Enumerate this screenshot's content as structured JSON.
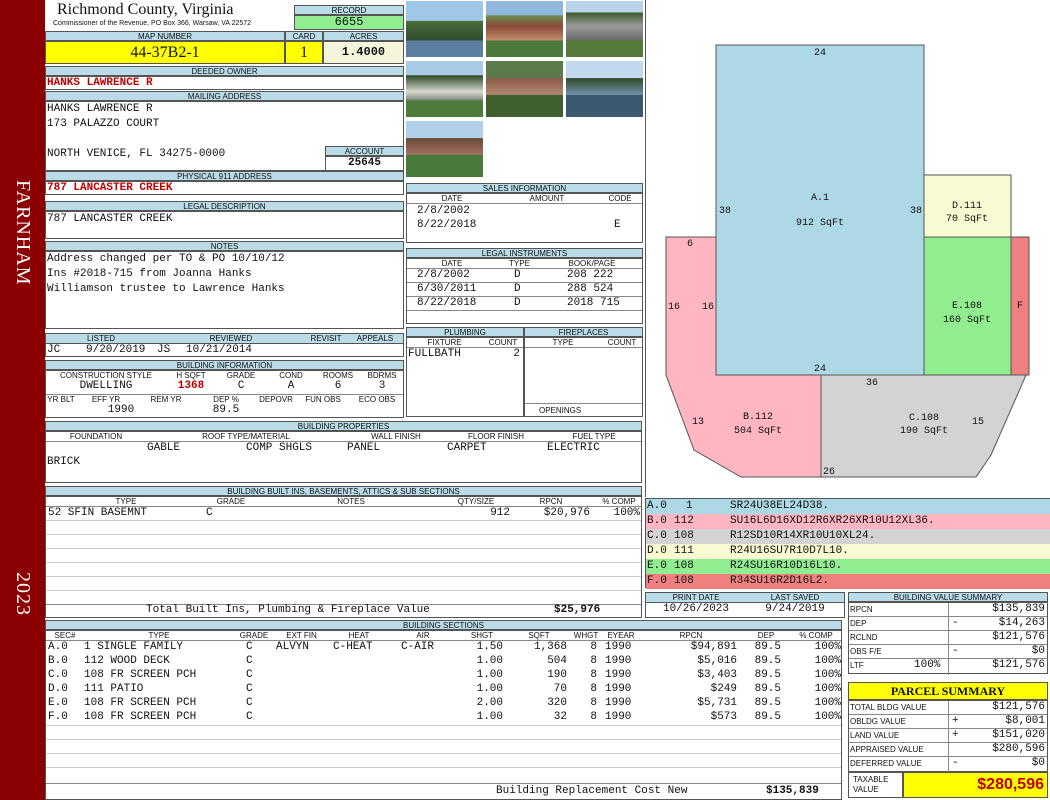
{
  "side": {
    "town": "FARNHAM",
    "year": "2023"
  },
  "header": {
    "county": "Richmond County, Virginia",
    "commissioner": "Commissioner of the Revenue, PO Box 366, Warsaw, VA 22572",
    "record_label": "RECORD",
    "record": "6655",
    "map_label": "MAP NUMBER",
    "map_number": "44-37B2-1",
    "card_label": "CARD",
    "card": "1",
    "acres_label": "ACRES",
    "acres": "1.4000"
  },
  "owner": {
    "label": "DEEDED OWNER",
    "name": "HANKS LAWRENCE R",
    "mail_label": "MAILING ADDRESS",
    "mail_lines": [
      "HANKS LAWRENCE R",
      "173 PALAZZO COURT",
      "",
      "NORTH VENICE, FL 34275-0000"
    ],
    "account_label": "ACCOUNT",
    "account": "25645",
    "phys_label": "PHYSICAL 911 ADDRESS",
    "phys": "787 LANCASTER CREEK"
  },
  "legal": {
    "label": "LEGAL DESCRIPTION",
    "text": "787 LANCASTER CREEK"
  },
  "notes": {
    "label": "NOTES",
    "lines": [
      "Address changed per TO & PO 10/10/12",
      "Ins #2018-715 from Joanna Hanks",
      "Williamson trustee to Lawrence Hanks"
    ]
  },
  "sales": {
    "label": "SALES INFORMATION",
    "cols": [
      "DATE",
      "AMOUNT",
      "CODE"
    ],
    "rows": [
      [
        "2/8/2002",
        "",
        ""
      ],
      [
        "8/22/2018",
        "",
        "E"
      ]
    ]
  },
  "instruments": {
    "label": "LEGAL INSTRUMENTS",
    "cols": [
      "DATE",
      "TYPE",
      "BOOK/PAGE"
    ],
    "rows": [
      [
        "2/8/2002",
        "D",
        "208 222"
      ],
      [
        "6/30/2011",
        "D",
        "288 524"
      ],
      [
        "8/22/2018",
        "D",
        "2018 715"
      ]
    ]
  },
  "listed": {
    "cols": [
      "LISTED",
      "REVIEWED",
      "REVISIT",
      "APPEALS"
    ],
    "listed_by": "JC",
    "listed_date": "9/20/2019",
    "reviewed_by": "JS",
    "reviewed_date": "10/21/2014"
  },
  "building_info": {
    "label": "BUILDING INFORMATION",
    "cols": [
      "CONSTRUCTION STYLE",
      "H SQFT",
      "GRADE",
      "COND",
      "ROOMS",
      "BDRMS"
    ],
    "vals": [
      "DWELLING",
      "1368",
      "C",
      "A",
      "6",
      "3"
    ],
    "cols2": [
      "YR BLT",
      "EFF YR",
      "REM YR",
      "DEP %",
      "DEPOVR",
      "FUN OBS",
      "ECO OBS"
    ],
    "vals2": [
      "",
      "1990",
      "",
      "89.5",
      "",
      "",
      ""
    ]
  },
  "plumbing": {
    "label": "PLUMBING",
    "cols": [
      "FIXTURE",
      "COUNT"
    ],
    "rows": [
      [
        "FULLBATH",
        "2"
      ]
    ]
  },
  "fireplaces": {
    "label": "FIREPLACES",
    "cols": [
      "TYPE",
      "COUNT"
    ],
    "openings_label": "OPENINGS"
  },
  "properties": {
    "label": "BUILDING PROPERTIES",
    "cols": [
      "FOUNDATION",
      "ROOF TYPE/MATERIAL",
      "WALL FINISH",
      "FLOOR FINISH",
      "FUEL TYPE"
    ],
    "foundation": "BRICK",
    "roof_type": "GABLE",
    "roof_mat": "COMP SHGLS",
    "wall": "PANEL",
    "floor": "CARPET",
    "fuel": "ELECTRIC"
  },
  "builtins": {
    "label": "BUILDING BUILT INS, BASEMENTS, ATTICS & SUB SECTIONS",
    "cols": [
      "TYPE",
      "GRADE",
      "NOTES",
      "QTY/SIZE",
      "RPCN",
      "% COMP"
    ],
    "rows": [
      [
        "52 SFIN BASEMNT",
        "C",
        "",
        "912",
        "$20,976",
        "100%"
      ]
    ],
    "total_label": "Total Built Ins, Plumbing & Fireplace Value",
    "total": "$25,976"
  },
  "sketch": {
    "labels": [
      {
        "id": "A.1",
        "area": "912 SqFt"
      },
      {
        "id": "B.112",
        "area": "504 SqFt"
      },
      {
        "id": "C.108",
        "area": "190 SqFt"
      },
      {
        "id": "D.111",
        "area": "70 SqFt"
      },
      {
        "id": "E.108",
        "area": "160 SqFt"
      },
      {
        "id": "F",
        "area": ""
      }
    ],
    "dims": [
      "24",
      "38",
      "38",
      "24",
      "6",
      "16",
      "16",
      "36",
      "13",
      "26",
      "15"
    ],
    "colors": {
      "A": "#add8e6",
      "B": "#ffb6c1",
      "C": "#d3d3d3",
      "D": "#fafad2",
      "E": "#90ee90",
      "F": "#f08080"
    }
  },
  "codes": [
    {
      "sec": "A.0",
      "code": "1",
      "desc": "SR24U38EL24D38.",
      "color": "#add8e6"
    },
    {
      "sec": "B.0",
      "code": "112",
      "desc": "SU16L6D16XD12R6XR26XR10U12XL36.",
      "color": "#ffb6c1"
    },
    {
      "sec": "C.0",
      "code": "108",
      "desc": "R12SD10R14XR10U10XL24.",
      "color": "#d3d3d3"
    },
    {
      "sec": "D.0",
      "code": "111",
      "desc": "R24U16SU7R10D7L10.",
      "color": "#fafad2"
    },
    {
      "sec": "E.0",
      "code": "108",
      "desc": "R24SU16R10D16L10.",
      "color": "#90ee90"
    },
    {
      "sec": "F.0",
      "code": "108",
      "desc": "R34SU16R2D16L2.",
      "color": "#f08080"
    }
  ],
  "print": {
    "cols": [
      "PRINT DATE",
      "LAST SAVED"
    ],
    "print_date": "10/26/2023",
    "last_saved": "9/24/2019"
  },
  "value_summary": {
    "label": "BUILDING VALUE SUMMARY",
    "rows": [
      [
        "RPCN",
        "",
        "$135,839"
      ],
      [
        "DEP",
        "-",
        "$14,263"
      ],
      [
        "RCLND",
        "",
        "$121,576"
      ],
      [
        "OBS F/E",
        "-",
        "$0"
      ],
      [
        "LTF",
        "100%",
        "$121,576"
      ]
    ]
  },
  "parcel": {
    "label": "PARCEL SUMMARY",
    "rows": [
      [
        "TOTAL BLDG VALUE",
        "",
        "$121,576"
      ],
      [
        "OBLDG VALUE",
        "+",
        "$8,001"
      ],
      [
        "LAND VALUE",
        "+",
        "$151,020"
      ],
      [
        "APPRAISED VALUE",
        "",
        "$280,596"
      ],
      [
        "DEFERRED VALUE",
        "-",
        "$0"
      ]
    ],
    "taxable_label": "TAXABLE VALUE",
    "taxable": "$280,596"
  },
  "sections": {
    "label": "BUILDING SECTIONS",
    "cols": [
      "SEC#",
      "TYPE",
      "GRADE",
      "EXT FIN",
      "HEAT",
      "AIR",
      "SHGT",
      "SQFT",
      "WHGT",
      "EYEAR",
      "RPCN",
      "DEP",
      "% COMP"
    ],
    "rows": [
      [
        "A.0",
        "1 SINGLE FAMILY",
        "C",
        "ALVYN",
        "C-HEAT",
        "C-AIR",
        "1.50",
        "1,368",
        "8",
        "1990",
        "$94,891",
        "89.5",
        "100%"
      ],
      [
        "B.0",
        "112 WOOD DECK",
        "C",
        "",
        "",
        "",
        "1.00",
        "504",
        "8",
        "1990",
        "$5,016",
        "89.5",
        "100%"
      ],
      [
        "C.0",
        "108 FR SCREEN PCH",
        "C",
        "",
        "",
        "",
        "1.00",
        "190",
        "8",
        "1990",
        "$3,403",
        "89.5",
        "100%"
      ],
      [
        "D.0",
        "111 PATIO",
        "C",
        "",
        "",
        "",
        "1.00",
        "70",
        "8",
        "1990",
        "$249",
        "89.5",
        "100%"
      ],
      [
        "E.0",
        "108 FR SCREEN PCH",
        "C",
        "",
        "",
        "",
        "2.00",
        "320",
        "8",
        "1990",
        "$5,731",
        "89.5",
        "100%"
      ],
      [
        "F.0",
        "108 FR SCREEN PCH",
        "C",
        "",
        "",
        "",
        "1.00",
        "32",
        "8",
        "1990",
        "$573",
        "89.5",
        "100%"
      ]
    ],
    "rcn_label": "Building Replacement Cost New",
    "rcn": "$135,839"
  }
}
